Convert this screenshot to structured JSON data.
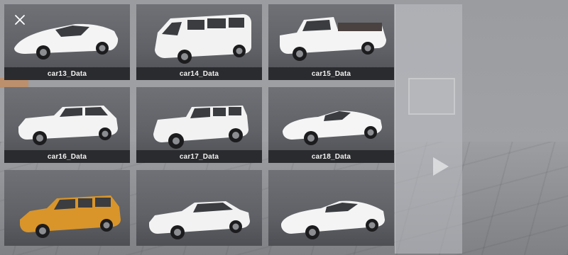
{
  "window": {
    "close_icon": "close-icon"
  },
  "cars": [
    {
      "label": "car13_Data",
      "body_color": "#f4f4f4",
      "style": "supercar"
    },
    {
      "label": "car14_Data",
      "body_color": "#f2f2f2",
      "style": "van"
    },
    {
      "label": "car15_Data",
      "body_color": "#f4f4f4",
      "style": "flatbed-truck"
    },
    {
      "label": "car16_Data",
      "body_color": "#f3f3f3",
      "style": "hatchback"
    },
    {
      "label": "car17_Data",
      "body_color": "#f2f2f2",
      "style": "suv"
    },
    {
      "label": "car18_Data",
      "body_color": "#f5f5f5",
      "style": "roadster"
    },
    {
      "label": "",
      "body_color": "#d9952a",
      "style": "wagon"
    },
    {
      "label": "",
      "body_color": "#f2f2f2",
      "style": "muscle"
    },
    {
      "label": "",
      "body_color": "#f4f4f4",
      "style": "sports"
    }
  ],
  "next_icon": "play-arrow-icon"
}
